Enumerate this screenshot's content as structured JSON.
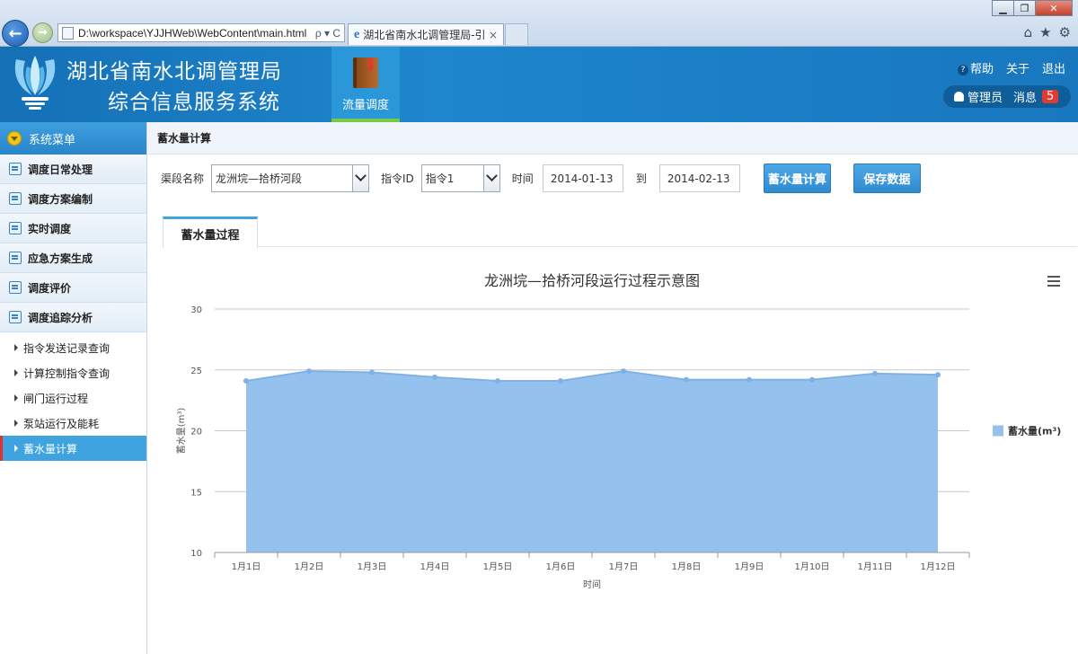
{
  "browser": {
    "url": "D:\\workspace\\YJJHWeb\\WebContent\\main.html",
    "url_tools": "ρ ▾ C",
    "tab_title": "湖北省南水北调管理局-引...",
    "tab_close": "×"
  },
  "header": {
    "title_line1": "湖北省南水北调管理局",
    "title_line2": "综合信息服务系统",
    "module_label": "流量调度",
    "help": "帮助",
    "about": "关于",
    "logout": "退出",
    "user": "管理员",
    "messages_label": "消息",
    "messages_count": "5"
  },
  "sidebar": {
    "header": "系统菜单",
    "items": [
      {
        "label": "调度日常处理",
        "icon": "list-icon"
      },
      {
        "label": "调度方案编制",
        "icon": "chat-icon"
      },
      {
        "label": "实时调度",
        "icon": "edit-icon"
      },
      {
        "label": "应急方案生成",
        "icon": "calendar-icon"
      },
      {
        "label": "调度评价",
        "icon": "calendar-icon"
      },
      {
        "label": "调度追踪分析",
        "icon": "calendar-icon"
      }
    ],
    "sub_items": [
      {
        "label": "指令发送记录查询"
      },
      {
        "label": "计算控制指令查询"
      },
      {
        "label": "闸门运行过程"
      },
      {
        "label": "泵站运行及能耗"
      },
      {
        "label": "蓄水量计算",
        "active": true
      }
    ]
  },
  "page": {
    "title": "蓄水量计算",
    "form": {
      "canal_label": "渠段名称",
      "canal_value": "龙洲垸—拾桥河段",
      "cmd_label": "指令ID",
      "cmd_value": "指令1",
      "time_label": "时间",
      "start_date": "2014-01-13",
      "to_label": "到",
      "end_date": "2014-02-13",
      "calc_button": "蓄水量计算",
      "save_button": "保存数据"
    },
    "tab_label": "蓄水量过程"
  },
  "colors": {
    "area_fill": "#95c1ee",
    "area_line": "#7fb1e6",
    "point": "#7fb1e6",
    "grid": "#c8c8c8"
  },
  "chart_data": {
    "type": "area",
    "title": "龙洲垸—拾桥河段运行过程示意图",
    "xlabel": "时间",
    "ylabel": "蓄水量(m³)",
    "categories": [
      "1月1日",
      "1月2日",
      "1月3日",
      "1月4日",
      "1月5日",
      "1月6日",
      "1月7日",
      "1月8日",
      "1月9日",
      "1月10日",
      "1月11日",
      "1月12日"
    ],
    "series": [
      {
        "name": "蓄水量(m³)",
        "values": [
          24.1,
          24.9,
          24.8,
          24.4,
          24.1,
          24.1,
          24.9,
          24.2,
          24.2,
          24.2,
          24.7,
          24.6
        ]
      }
    ],
    "ylim": [
      10,
      30
    ],
    "yticks": [
      10,
      15,
      20,
      25,
      30
    ],
    "grid": true,
    "legend_position": "right"
  }
}
